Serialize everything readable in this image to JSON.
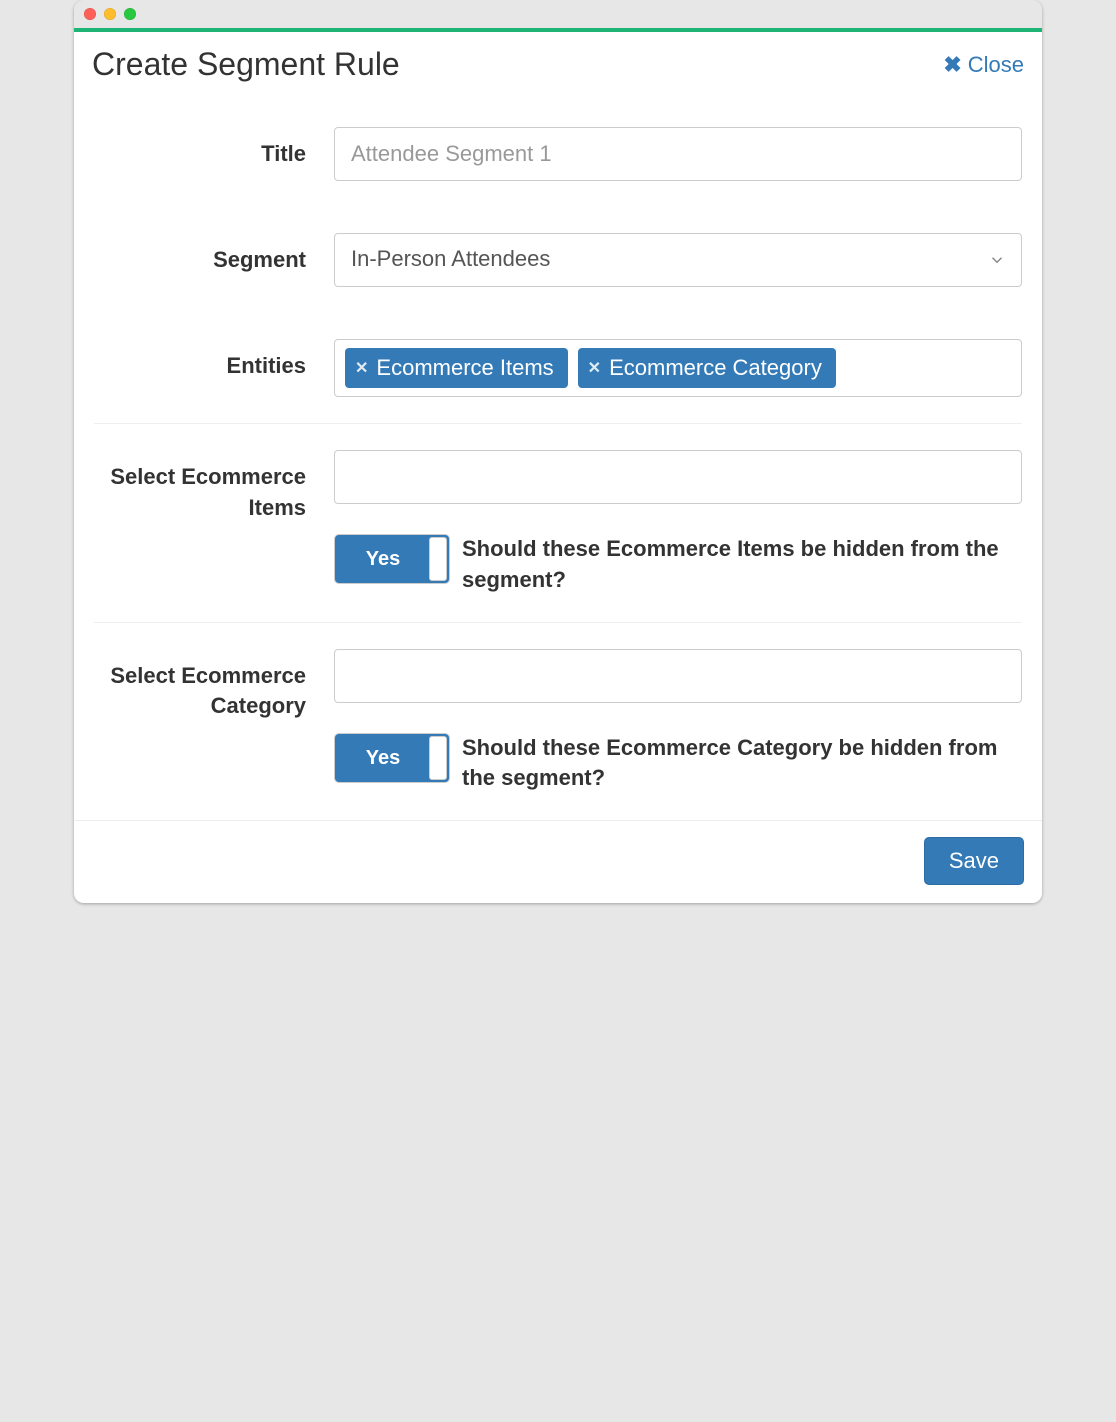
{
  "header": {
    "title": "Create Segment Rule",
    "close_label": "Close"
  },
  "fields": {
    "title": {
      "label": "Title",
      "placeholder": "Attendee Segment 1",
      "value": ""
    },
    "segment": {
      "label": "Segment",
      "selected": "In-Person Attendees"
    },
    "entities": {
      "label": "Entities",
      "tags": [
        "Ecommerce Items",
        "Ecommerce Category"
      ]
    },
    "select_items": {
      "label": "Select Ecommerce Items",
      "toggle_label": "Yes",
      "question": "Should these Ecommerce Items be hidden from the segment?"
    },
    "select_category": {
      "label": "Select Ecommerce Category",
      "toggle_label": "Yes",
      "question": "Should these Ecommerce Category be hidden from the segment?"
    }
  },
  "footer": {
    "save_label": "Save"
  }
}
